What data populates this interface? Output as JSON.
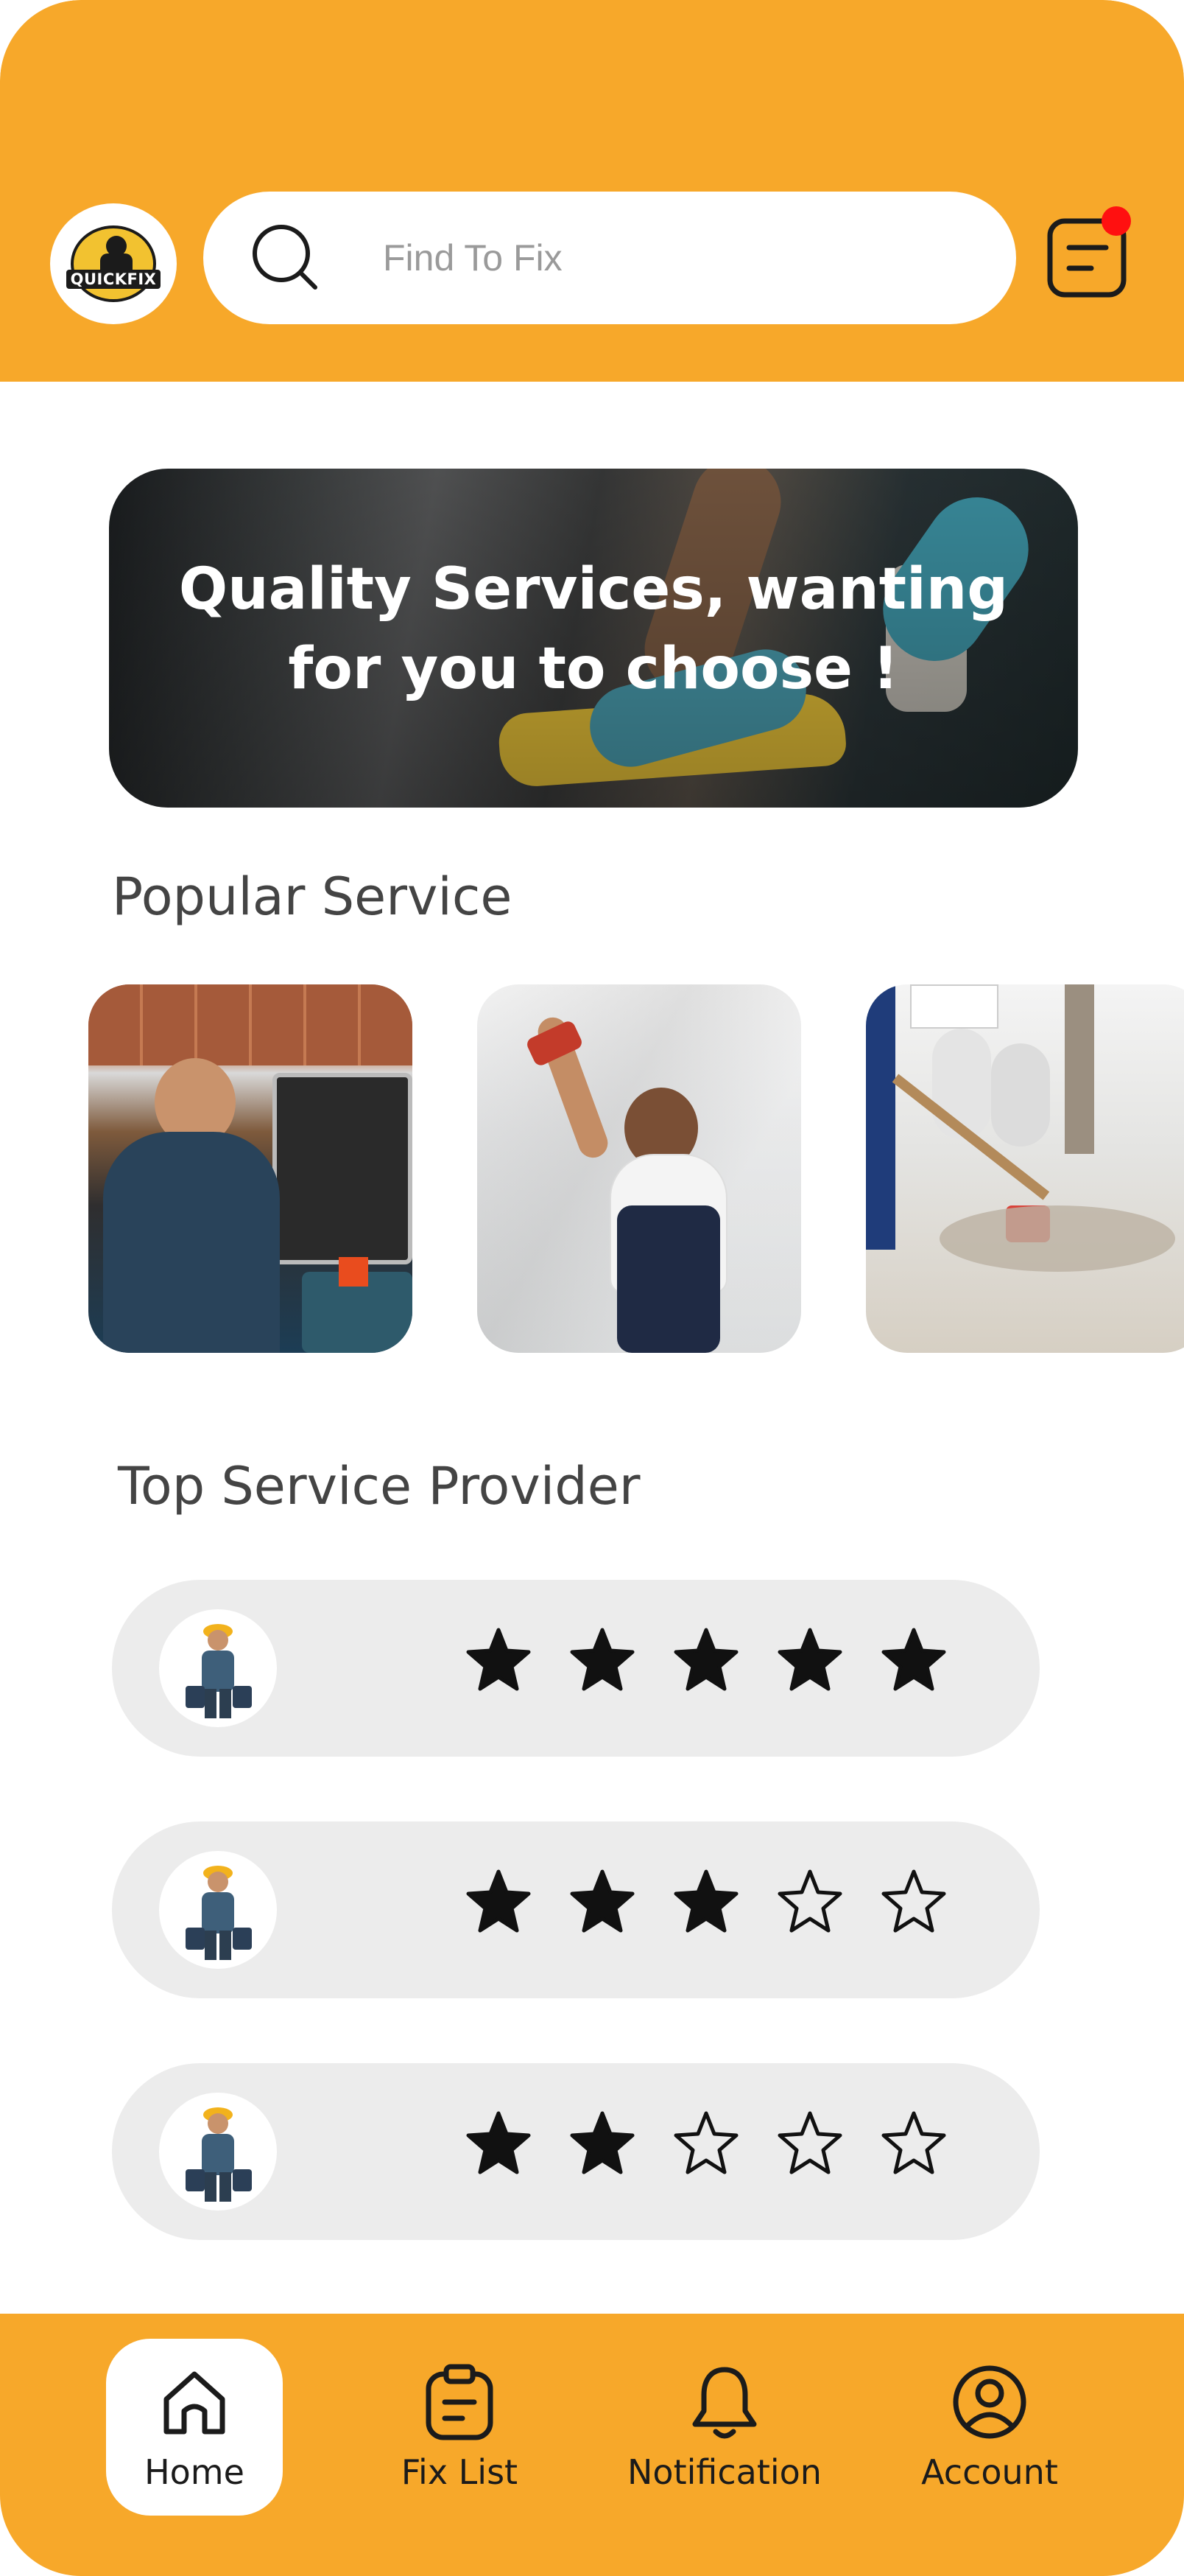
{
  "app": {
    "logo_text": "QUICKFIX",
    "accent_color": "#f7a82a",
    "notification_dot_color": "#ff1010"
  },
  "header": {
    "search_placeholder": "Find To Fix",
    "search_icon": "search-icon",
    "menu_icon": "document-list-icon",
    "has_notification": true
  },
  "banner": {
    "title_line1": "Quality Services, wanting",
    "title_line2": "for you to choose !"
  },
  "popular": {
    "title": "Popular Service",
    "cards": [
      {
        "icon": "oven-repair-photo"
      },
      {
        "icon": "plumber-photo"
      },
      {
        "icon": "cleaning-photo"
      }
    ]
  },
  "providers": {
    "title": "Top Service Provider",
    "items": [
      {
        "rating": 5,
        "max": 5
      },
      {
        "rating": 3,
        "max": 5
      },
      {
        "rating": 2,
        "max": 5
      }
    ]
  },
  "nav": {
    "items": [
      {
        "label": "Home",
        "icon": "home-icon",
        "active": true
      },
      {
        "label": "Fix List",
        "icon": "clipboard-icon",
        "active": false
      },
      {
        "label": "Notification",
        "icon": "bell-icon",
        "active": false
      },
      {
        "label": "Account",
        "icon": "user-icon",
        "active": false
      }
    ]
  }
}
